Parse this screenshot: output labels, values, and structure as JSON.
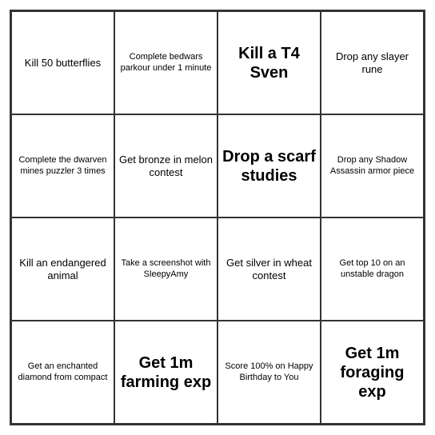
{
  "grid": {
    "rows": [
      [
        {
          "text": "Kill 50 butterflies",
          "size": "medium-text"
        },
        {
          "text": "Complete bedwars parkour under 1 minute",
          "size": "small-text"
        },
        {
          "text": "Kill a T4 Sven",
          "size": "large-text"
        },
        {
          "text": "Drop any slayer rune",
          "size": "medium-text"
        }
      ],
      [
        {
          "text": "Complete the dwarven mines puzzler 3 times",
          "size": "small-text"
        },
        {
          "text": "Get bronze in melon contest",
          "size": "medium-text"
        },
        {
          "text": "Drop a scarf studies",
          "size": "large-text"
        },
        {
          "text": "Drop any Shadow Assassin armor piece",
          "size": "small-text"
        }
      ],
      [
        {
          "text": "Kill an endangered animal",
          "size": "medium-text"
        },
        {
          "text": "Take a screenshot with SleepyAmy",
          "size": "small-text"
        },
        {
          "text": "Get silver in wheat contest",
          "size": "medium-text"
        },
        {
          "text": "Get top 10 on an unstable dragon",
          "size": "small-text"
        }
      ],
      [
        {
          "text": "Get an enchanted diamond from compact",
          "size": "small-text"
        },
        {
          "text": "Get 1m farming exp",
          "size": "large-text"
        },
        {
          "text": "Score 100% on Happy Birthday to You",
          "size": "small-text"
        },
        {
          "text": "Get 1m foraging exp",
          "size": "large-text"
        }
      ]
    ]
  }
}
